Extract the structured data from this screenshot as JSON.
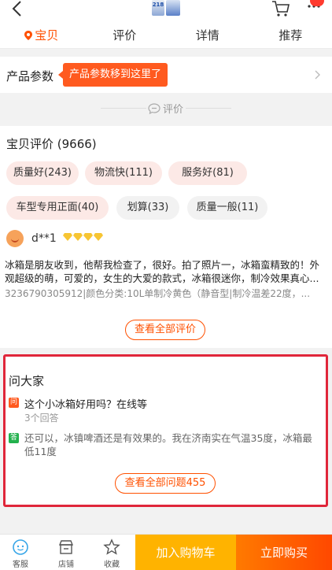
{
  "tabs": [
    {
      "label": "宝贝",
      "active": true
    },
    {
      "label": "评价",
      "active": false
    },
    {
      "label": "详情",
      "active": false
    },
    {
      "label": "推荐",
      "active": false
    }
  ],
  "product_thumb_text": "218",
  "params": {
    "label": "产品参数",
    "tip": "产品参数移到这里了"
  },
  "divider_label": "评价",
  "reviews": {
    "title": "宝贝评价 (9666)",
    "tags": [
      "质量好(243)",
      "物流快(111)",
      "服务好(81)",
      "车型专用正面(40)",
      "划算(33)",
      "质量一般(11)"
    ],
    "user": "d**1",
    "body": "冰箱是朋友收到，他帮我检查了，很好。拍了照片一，冰箱蛮精致的！外观超级的萌，可爱的，女生的大爱的款式，冰箱很迷你，制冷效果真心...",
    "meta": "3236790305912|颜色分类:10L单制冷黄色（静音型|制冷温差22度，...",
    "view_all": "查看全部评价"
  },
  "qa": {
    "title": "问大家",
    "q_icon": "问",
    "question": "这个小冰箱好用吗？在线等",
    "answer_count": "3个回答",
    "a_icon": "答",
    "answer": "还可以，冰镇啤酒还是有效果的。我在济南实在气温35度，冰箱最低11度",
    "view_all": "查看全部问题455"
  },
  "bottom": {
    "service": "客服",
    "store": "店铺",
    "favorite": "收藏",
    "add_cart": "加入购物车",
    "buy_now": "立即购买"
  },
  "colors": {
    "accent": "#ff5000",
    "highlight_border": "#e0263a",
    "cart_button": "#ffb300"
  }
}
